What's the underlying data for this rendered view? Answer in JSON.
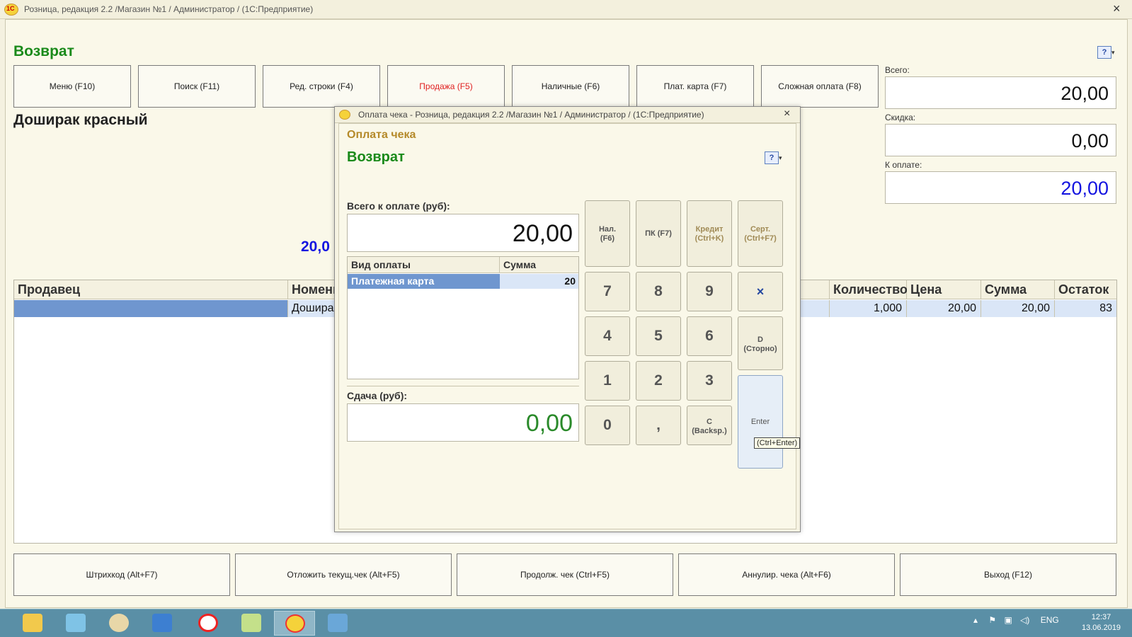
{
  "window": {
    "title": "Розница, редакция 2.2 /Магазин №1 / Администратор /  (1С:Предприятие)",
    "close_glyph": "×"
  },
  "main": {
    "heading": "Возврат",
    "function_buttons": [
      {
        "label": "Меню (F10)"
      },
      {
        "label": "Поиск (F11)"
      },
      {
        "label": "Ред. строки (F4)"
      },
      {
        "label": "Продажа (F5)"
      },
      {
        "label": "Наличные (F6)"
      },
      {
        "label": "Плат. карта (F7)"
      },
      {
        "label": "Сложная оплата (F8)"
      }
    ],
    "product_name": "Доширак красный",
    "big_amount": "20,0",
    "totals": {
      "total_label": "Всего:",
      "total_value": "20,00",
      "discount_label": "Скидка:",
      "discount_value": "0,00",
      "to_pay_label": "К оплате:",
      "to_pay_value": "20,00"
    },
    "table": {
      "columns": [
        "Продавец",
        "Номенк",
        "Количество",
        "Цена",
        "Сумма",
        "Остаток"
      ],
      "rows": [
        {
          "seller": "",
          "item": "Дошира",
          "qty": "1,000",
          "price": "20,00",
          "sum": "20,00",
          "rest": "83"
        }
      ]
    },
    "bottom_buttons": [
      {
        "label": "Штрихкод (Alt+F7)"
      },
      {
        "label": "Отложить текущ.чек (Alt+F5)"
      },
      {
        "label": "Продолж. чек (Ctrl+F5)"
      },
      {
        "label": "Аннулир. чека (Alt+F6)"
      },
      {
        "label": "Выход (F12)"
      }
    ]
  },
  "dialog": {
    "title": "Оплата чека - Розница, редакция 2.2 /Магазин №1 / Администратор /  (1С:Предприятие)",
    "subtitle": "Оплата чека",
    "heading": "Возврат",
    "total_label": "Всего к оплате (руб):",
    "total_value": "20,00",
    "grid": {
      "col_type": "Вид оплаты",
      "col_sum": "Сумма",
      "rows": [
        {
          "type": "Платежная карта",
          "sum": "20"
        }
      ]
    },
    "change_label": "Сдача (руб):",
    "change_value": "0,00",
    "keypad": {
      "cash_l1": "Нал.",
      "cash_l2": "(F6)",
      "card": "ПК (F7)",
      "credit_l1": "Кредит",
      "credit_l2": "(Ctrl+K)",
      "cert_l1": "Серт.",
      "cert_l2": "(Ctrl+F7)",
      "k7": "7",
      "k8": "8",
      "k9": "9",
      "clear": "×",
      "k4": "4",
      "k5": "5",
      "k6": "6",
      "storno_l1": "D",
      "storno_l2": "(Сторно)",
      "k1": "1",
      "k2": "2",
      "k3": "3",
      "k0": "0",
      "comma": ",",
      "back_l1": "C",
      "back_l2": "(Backsp.)",
      "enter": "Enter",
      "tooltip": "(Ctrl+Enter)"
    }
  },
  "taskbar": {
    "language": "ENG",
    "time": "12:37",
    "date": "13.06.2019"
  }
}
